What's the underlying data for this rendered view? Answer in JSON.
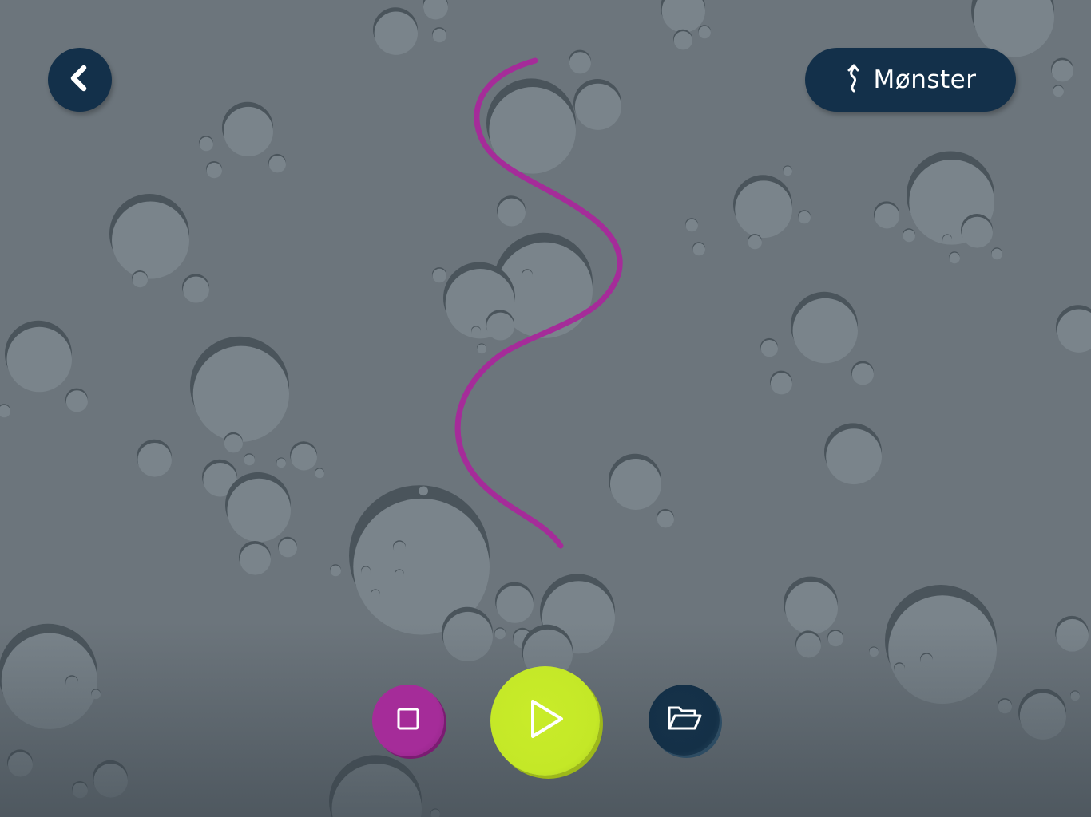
{
  "app": {
    "pattern_button_label": "Mønster"
  },
  "icons": {
    "back": "chevron-left-icon",
    "pattern": "squiggle-arrow-up-icon",
    "stop": "square-stop-icon",
    "play": "play-triangle-icon",
    "open": "open-folder-icon"
  },
  "colors": {
    "background": "#6c757c",
    "crater_fill": "#7a848b",
    "crater_shadow": "#4a545b",
    "button_dark": "#13304a",
    "drawn_path": "#a52c99",
    "stop_button": "#a52c99",
    "play_button": "#c4e827",
    "open_button": "#143047"
  }
}
